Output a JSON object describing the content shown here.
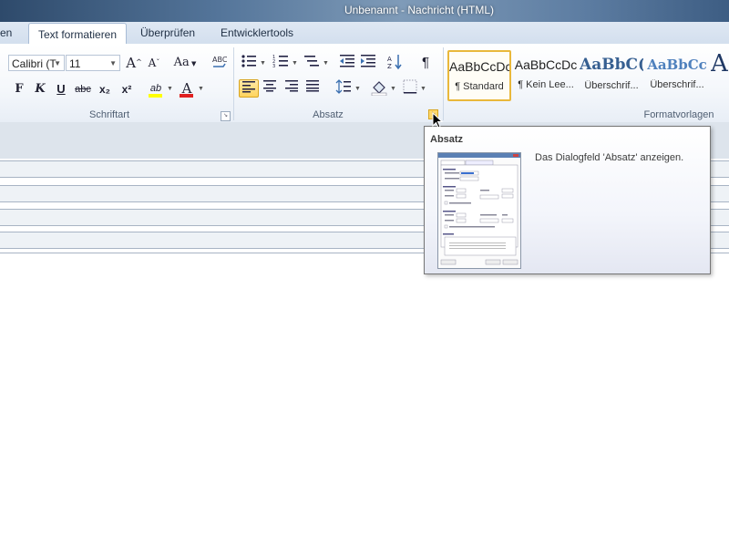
{
  "window": {
    "title": "Unbenannt - Nachricht (HTML)"
  },
  "tabs": [
    {
      "label": "en"
    },
    {
      "label": "Text formatieren"
    },
    {
      "label": "Überprüfen"
    },
    {
      "label": "Entwicklertools"
    }
  ],
  "font_group": {
    "label": "Schriftart",
    "font_name": "Calibri (T",
    "font_size": "11",
    "grow_label": "A",
    "shrink_label": "A",
    "case_label": "Aa",
    "bold": "F",
    "italic": "K",
    "underline": "U",
    "strike": "abc",
    "subscript": "x₂",
    "superscript": "x²",
    "highlight": "ab",
    "font_color": "A"
  },
  "paragraph_group": {
    "label": "Absatz",
    "pilcrow": "¶"
  },
  "styles_group": {
    "label": "Formatvorlagen",
    "items": [
      {
        "sample": "AaBbCcDc",
        "name": "¶ Standard"
      },
      {
        "sample": "AaBbCcDc",
        "name": "¶ Kein Lee..."
      },
      {
        "sample": "AaBbC(",
        "name": "Überschrif..."
      },
      {
        "sample": "AaBbCc",
        "name": "Überschrif..."
      },
      {
        "sample": "A",
        "name": ""
      }
    ]
  },
  "tooltip": {
    "title": "Absatz",
    "description": "Das Dialogfeld 'Absatz' anzeigen."
  },
  "colors": {
    "highlight": "#ffff00",
    "font_color": "#e02020",
    "selected": "#ffd45e",
    "heading1": "#365f91",
    "heading2": "#4f81bd"
  }
}
